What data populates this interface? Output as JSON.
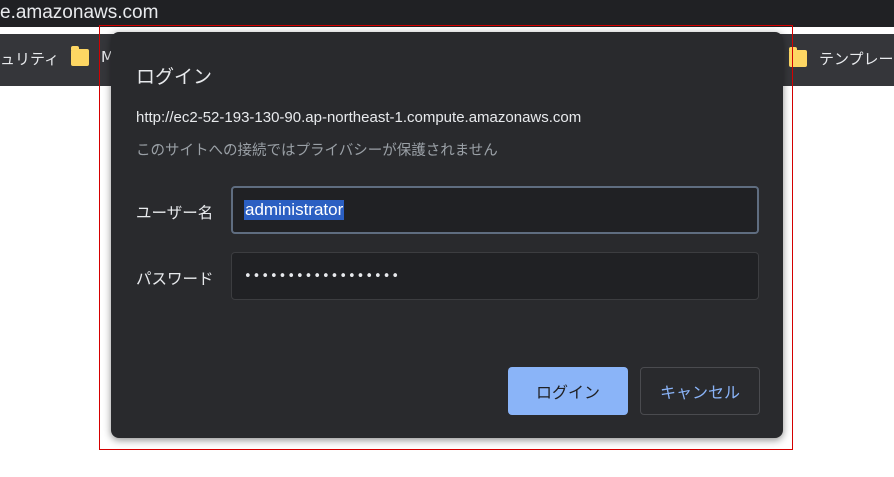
{
  "browser": {
    "url_fragment": "e.amazonaws.com"
  },
  "bookmarks_bar": {
    "items": [
      {
        "label": "ュリティ"
      },
      {
        "label": "M"
      },
      {
        "label": "テンプレート"
      }
    ]
  },
  "dialog": {
    "title": "ログイン",
    "site_url": "http://ec2-52-193-130-90.ap-northeast-1.compute.amazonaws.com",
    "privacy_warning": "このサイトへの接続ではプライバシーが保護されません",
    "username_label": "ユーザー名",
    "username_value": "administrator",
    "password_label": "パスワード",
    "password_value": "••••••••••••••••••",
    "login_button": "ログイン",
    "cancel_button": "キャンセル"
  },
  "colors": {
    "dialog_bg": "#292a2d",
    "primary_button": "#8ab4f8",
    "selection": "#2b5fc2",
    "highlight_frame": "#d40000"
  }
}
